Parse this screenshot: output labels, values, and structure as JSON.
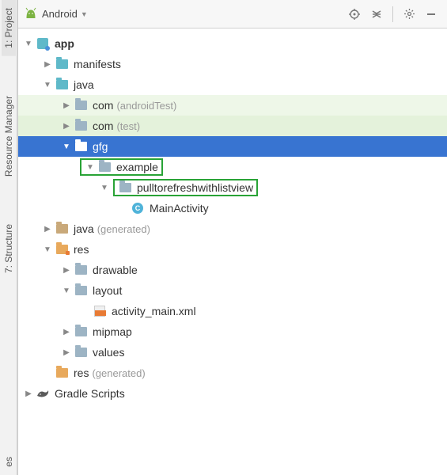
{
  "toolbar": {
    "view_label": "Android"
  },
  "sidebar": {
    "tab1": "1: Project",
    "tab2": "Resource Manager",
    "tab3": "7: Structure",
    "tab4": "es"
  },
  "tree": {
    "app": "app",
    "manifests": "manifests",
    "java": "java",
    "com1": "com",
    "com1_q": "(androidTest)",
    "com2": "com",
    "com2_q": "(test)",
    "gfg": "gfg",
    "example": "example",
    "pull": "pulltorefreshwithlistview",
    "mainactivity": "MainActivity",
    "java_gen": "java",
    "java_gen_q": "(generated)",
    "res": "res",
    "drawable": "drawable",
    "layout": "layout",
    "activity_main": "activity_main.xml",
    "mipmap": "mipmap",
    "values": "values",
    "res_gen": "res",
    "res_gen_q": "(generated)",
    "gradle": "Gradle Scripts"
  }
}
